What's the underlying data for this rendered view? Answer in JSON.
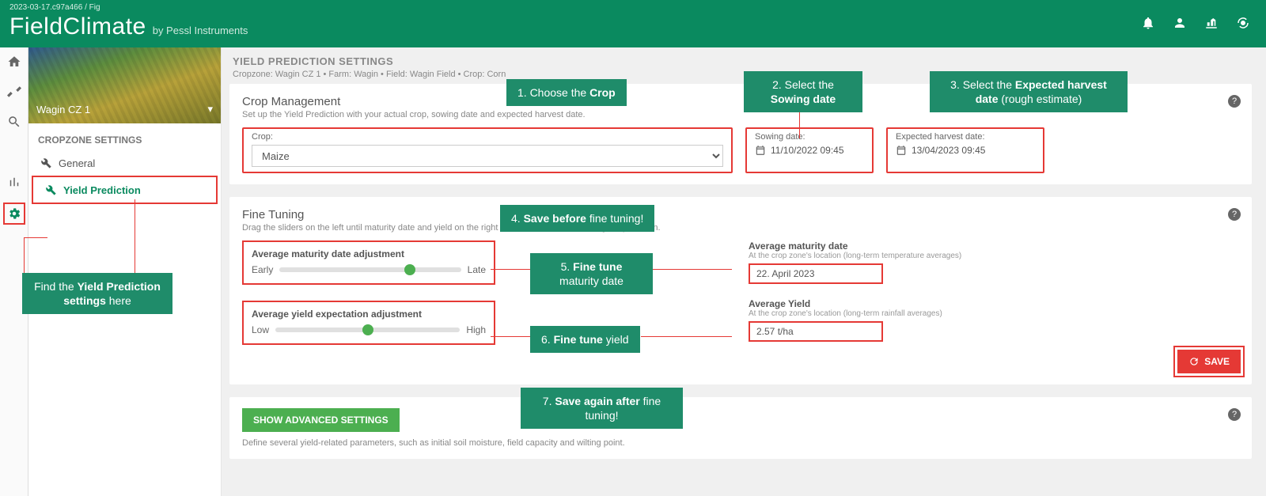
{
  "build_tag": "2023-03-17.c97a466 / Fig",
  "brand": "FieldClimate",
  "brand_sub": "by Pessl Instruments",
  "sidebar": {
    "cropzone": "Wagin CZ 1",
    "section_title": "CROPZONE SETTINGS",
    "items": [
      {
        "label": "General"
      },
      {
        "label": "Yield Prediction"
      }
    ]
  },
  "page": {
    "title": "YIELD PREDICTION SETTINGS",
    "crumbs": "Cropzone: Wagin CZ 1 • Farm: Wagin • Field: Wagin Field • Crop: Corn"
  },
  "crop_mgmt": {
    "heading": "Crop Management",
    "sub": "Set up the Yield Prediction with your actual crop, sowing date and expected harvest date.",
    "crop_lbl": "Crop:",
    "crop_value": "Maize",
    "sowing_lbl": "Sowing date:",
    "sowing_value": "11/10/2022 09:45",
    "harvest_lbl": "Expected harvest date:",
    "harvest_value": "13/04/2023 09:45"
  },
  "fine_tuning": {
    "heading": "Fine Tuning",
    "sub": "Drag the sliders on the left until maturity date and yield on the right match the location's average expectation.",
    "slider1_title": "Average maturity date adjustment",
    "slider1_left": "Early",
    "slider1_right": "Late",
    "slider2_title": "Average yield expectation adjustment",
    "slider2_left": "Low",
    "slider2_right": "High",
    "maturity_title": "Average maturity date",
    "maturity_sub": "At the crop zone's location (long-term temperature averages)",
    "maturity_value": "22. April 2023",
    "yield_title": "Average Yield",
    "yield_sub": "At the crop zone's location (long-term rainfall averages)",
    "yield_value": "2.57 t/ha",
    "save_label": "SAVE"
  },
  "adv": {
    "button": "SHOW ADVANCED SETTINGS",
    "desc": "Define several yield-related parameters, such as initial soil moisture, field capacity and wilting point."
  },
  "callouts": {
    "find": "Find the <b>Yield Prediction settings</b> here",
    "c1": "1. Choose the <b>Crop</b>",
    "c2": "2. Select the <b>Sowing date</b>",
    "c3": "3. Select the <b>Expected harvest date</b> (rough estimate)",
    "c4": "4. <b>Save before</b> fine tuning!",
    "c5": "5. <b>Fine tune</b> maturity date",
    "c6": "6. <b>Fine tune</b> yield",
    "c7": "7. <b>Save again after</b> fine tuning!"
  }
}
